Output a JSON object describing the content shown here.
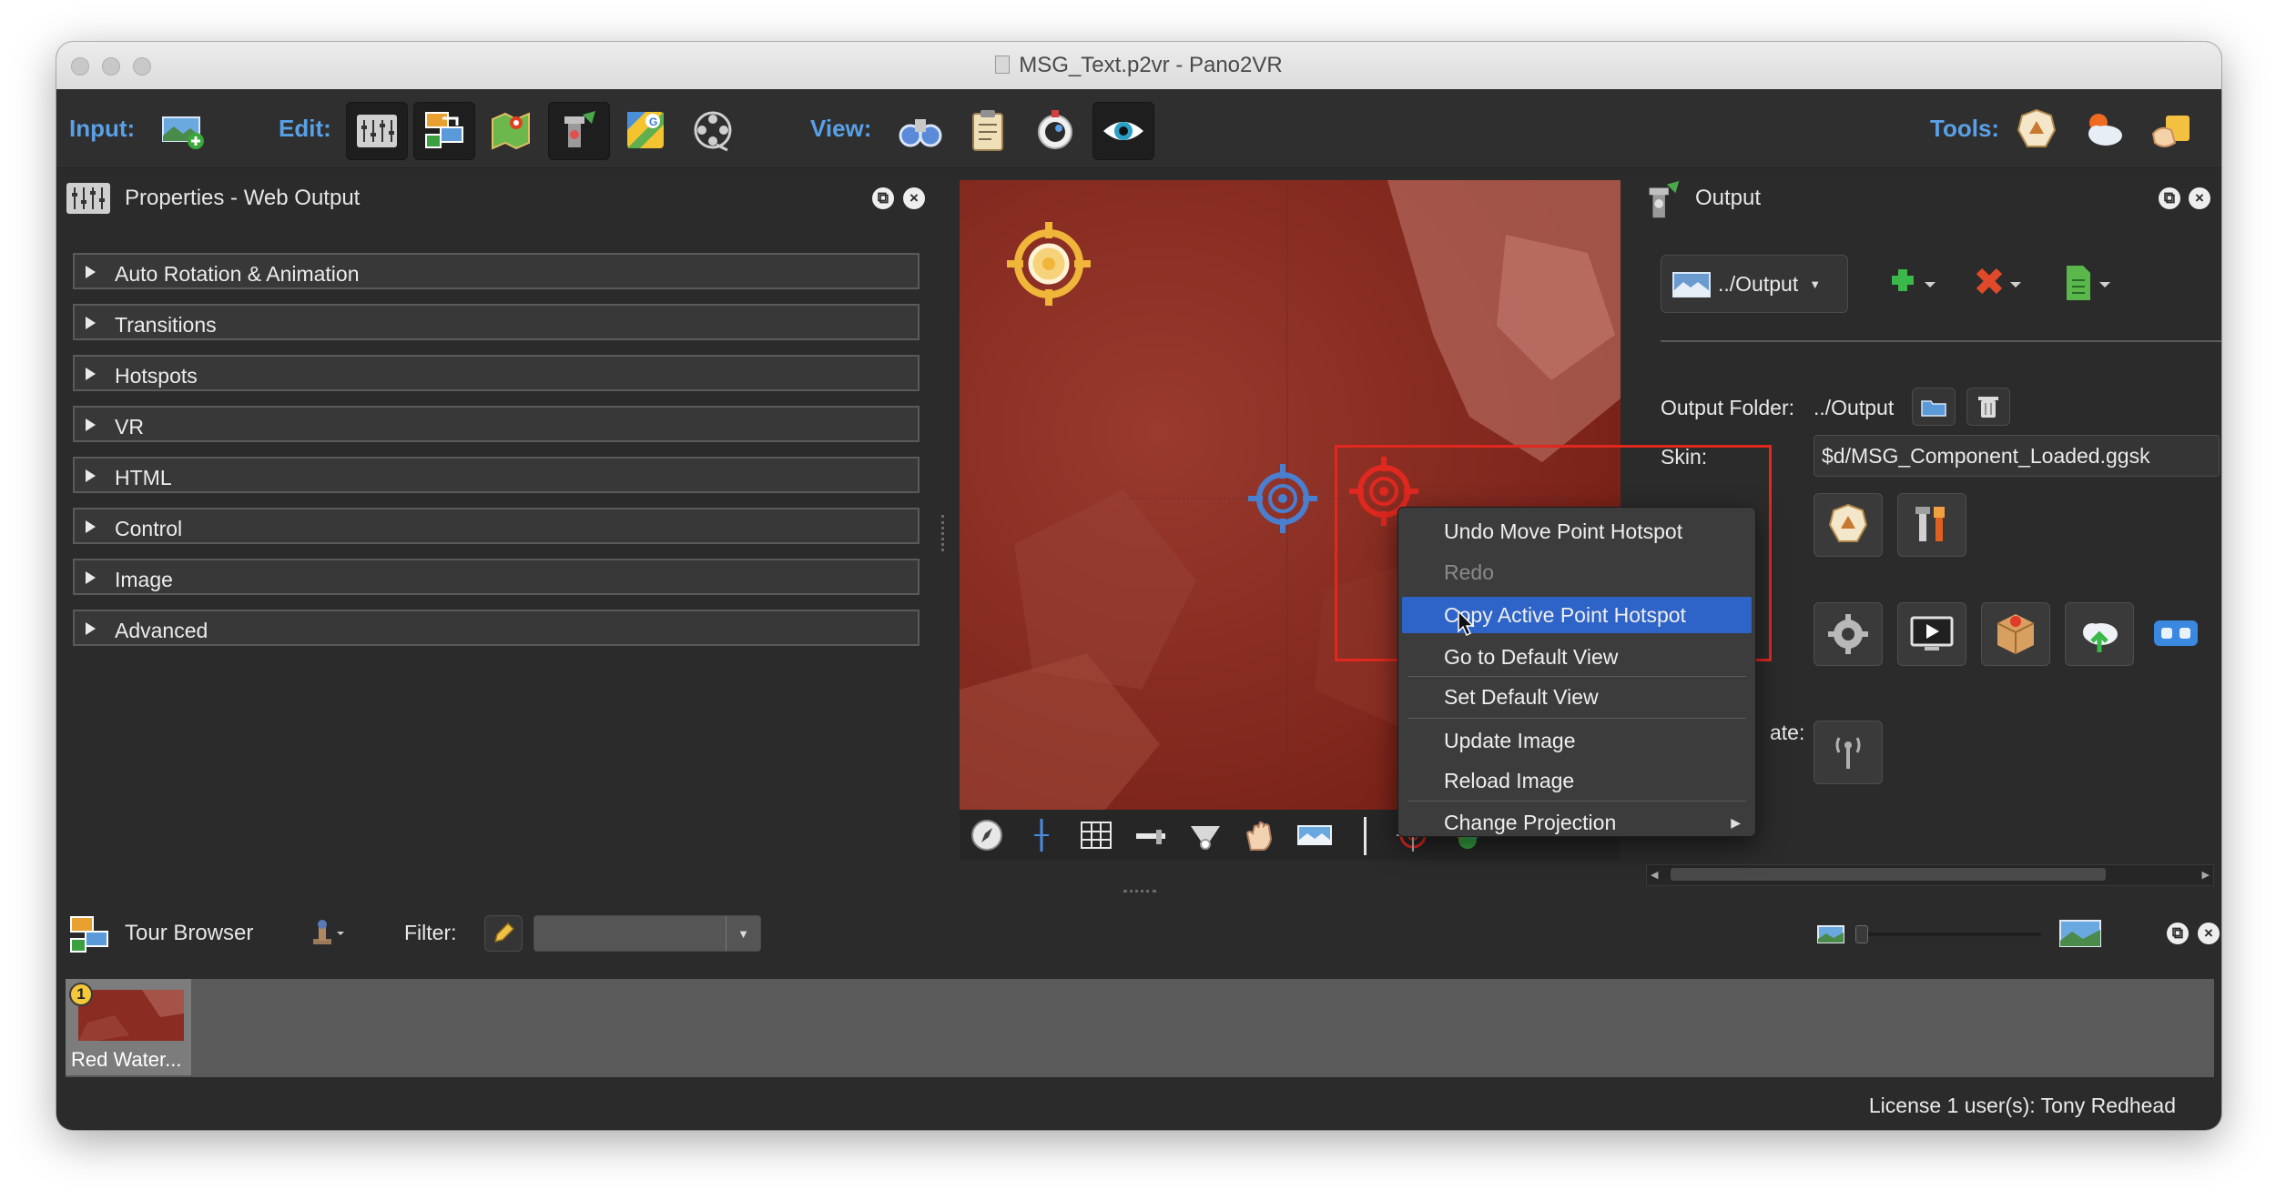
{
  "window": {
    "title": "MSG_Text.p2vr - Pano2VR"
  },
  "toolbar": {
    "input_label": "Input:",
    "edit_label": "Edit:",
    "view_label": "View:",
    "tools_label": "Tools:",
    "input_buttons": [
      "add-panorama-icon"
    ],
    "edit_buttons": [
      "properties-icon",
      "tour-browser-icon",
      "tour-map-icon",
      "patch-editor-icon",
      "maps-icon",
      "animation-icon"
    ],
    "view_buttons": [
      "binoculars-icon",
      "clipboard-icon",
      "viewer-icon",
      "eye-icon"
    ],
    "tools_buttons": [
      "skin-editor-icon",
      "cloud-tools-icon",
      "hand-tools-icon"
    ]
  },
  "properties_panel": {
    "title": "Properties - Web Output",
    "sections": [
      "Auto Rotation & Animation",
      "Transitions",
      "Hotspots",
      "VR",
      "HTML",
      "Control",
      "Image",
      "Advanced"
    ]
  },
  "context_menu": {
    "items": [
      {
        "label": "Undo Move Point Hotspot",
        "state": "normal"
      },
      {
        "label": "Redo",
        "state": "disabled"
      },
      {
        "label": "Copy Active Point Hotspot",
        "state": "active"
      },
      {
        "label": "Go to Default View",
        "state": "normal"
      },
      {
        "label": "Set Default View",
        "state": "normal"
      },
      {
        "label": "Update Image",
        "state": "normal"
      },
      {
        "label": "Reload Image",
        "state": "normal"
      },
      {
        "label": "Change Projection",
        "state": "submenu"
      }
    ]
  },
  "output_panel": {
    "title": "Output",
    "output_select": "../Output",
    "output_folder_label": "Output Folder:",
    "output_folder_value": "../Output",
    "skin_label": "Skin:",
    "skin_value": "$d/MSG_Component_Loaded.ggsk",
    "partial_label": "ate:"
  },
  "tour_browser": {
    "title": "Tour Browser",
    "filter_label": "Filter:",
    "filter_value": "",
    "thumbnails": [
      {
        "badge": "1",
        "label": "Red Water..."
      }
    ]
  },
  "status": {
    "license": "License 1 user(s): Tony Redhead"
  },
  "colors": {
    "accent_blue": "#5aa0e6",
    "menu_highlight": "#2e64c8",
    "annotation_red": "#e0281f",
    "hotspot_blue": "#4a7fd0",
    "hotspot_yellow": "#f0b63a"
  }
}
